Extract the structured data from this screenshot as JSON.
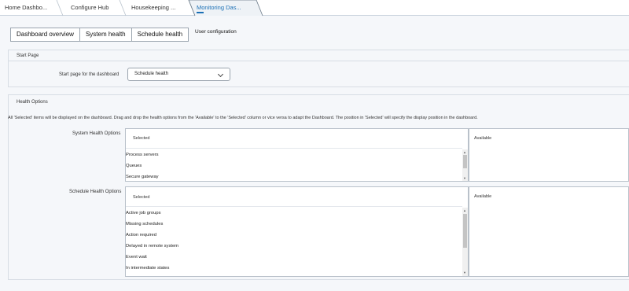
{
  "tabs": [
    {
      "label": "Home Dashbo..."
    },
    {
      "label": "Configure Hub"
    },
    {
      "label": "Housekeeping ..."
    },
    {
      "label": "Monitoring Das..."
    }
  ],
  "subtabs": {
    "dashboard_overview": "Dashboard overview",
    "system_health": "System health",
    "schedule_health": "Schedule health",
    "user_configuration": "User configuration"
  },
  "start_page": {
    "section_title": "Start Page",
    "label": "Start page for the dashboard",
    "selected_value": "Schedule health"
  },
  "health_options": {
    "section_title": "Health Options",
    "description": "All 'Selected' items will be displayed on the dashboard. Drag and drop the health options from the 'Available' to the 'Selected' column or vice versa to adapt the Dashboard. The position in 'Selected' will specify the display position in the dashboard.",
    "system": {
      "label": "System Health Options",
      "selected_header": "Selected",
      "available_header": "Available",
      "selected_items": [
        "Process servers",
        "Queues",
        "Secure gateway"
      ]
    },
    "schedule": {
      "label": "Schedule Health Options",
      "selected_header": "Selected",
      "available_header": "Available",
      "selected_items": [
        "Active job groups",
        "Missing schedules",
        "Action required",
        "Delayed in remote system",
        "Event wait",
        "In intermediate states"
      ]
    }
  }
}
